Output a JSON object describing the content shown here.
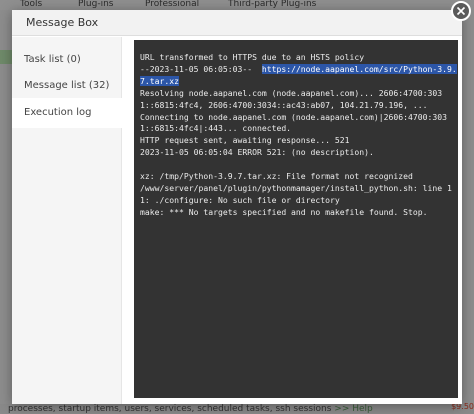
{
  "background": {
    "tabs": [
      "Tools",
      "Plug-ins",
      "Professional",
      "Third-party Plug-ins"
    ],
    "bottom_text": "processes, startup items, users, services, scheduled tasks, ssh sessions",
    "bottom_link": ">> Help",
    "price": "$9.50"
  },
  "modal": {
    "title": "Message Box",
    "sidebar": [
      {
        "label": "Task list (0)",
        "active": false
      },
      {
        "label": "Message list (32)",
        "active": false
      },
      {
        "label": "Execution log",
        "active": true
      }
    ],
    "log": {
      "lines_before": [
        "URL transformed to HTTPS due to an HSTS policy"
      ],
      "line2_prefix": "--2023-11-05 06:05:03--  ",
      "line2_url_a": "https://node.aapanel.com/src/Python-3.9.",
      "line3_url_b": "7.tar.xz",
      "lines_after": [
        "Resolving node.aapanel.com (node.aapanel.com)... 2606:4700:303",
        "1::6815:4fc4, 2606:4700:3034::ac43:ab07, 104.21.79.196, ...",
        "Connecting to node.aapanel.com (node.aapanel.com)|2606:4700:303",
        "1::6815:4fc4|:443... connected.",
        "HTTP request sent, awaiting response... 521",
        "2023-11-05 06:05:04 ERROR 521: (no description).",
        "",
        "xz: /tmp/Python-3.9.7.tar.xz: File format not recognized",
        "/www/server/panel/plugin/pythonmamager/install_python.sh: line 1",
        "1: ./configure: No such file or directory",
        "make: *** No targets specified and no makefile found. Stop."
      ]
    }
  },
  "colors": {
    "console_bg": "#333333",
    "selection": "#2c56a8",
    "overlay": "#7b7b7b"
  }
}
